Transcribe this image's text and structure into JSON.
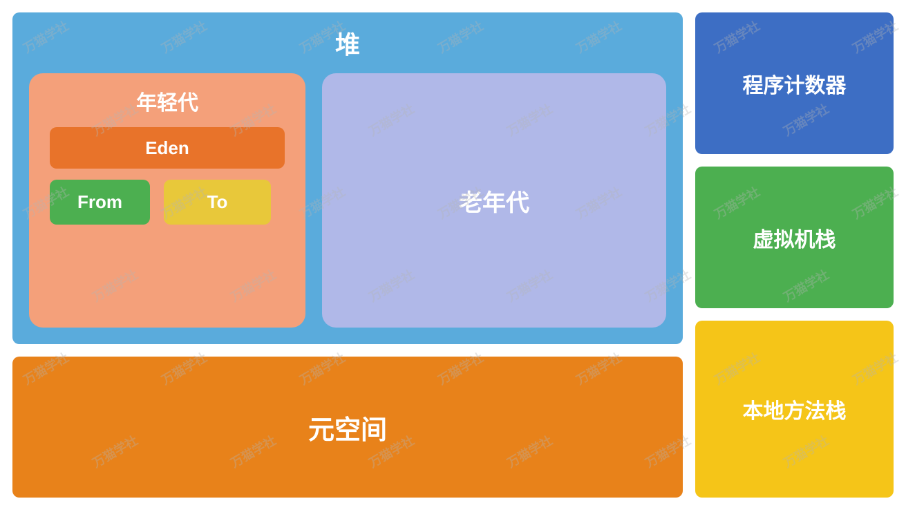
{
  "heap": {
    "title": "堆",
    "youngGen": {
      "title": "年轻代",
      "eden": "Eden",
      "from": "From",
      "to": "To"
    },
    "oldGen": {
      "title": "老年代"
    }
  },
  "metaspace": {
    "title": "元空间"
  },
  "programCounter": {
    "title": "程序计数器"
  },
  "vmStack": {
    "title": "虚拟机栈"
  },
  "nativeMethodStack": {
    "title": "本地方法栈"
  },
  "watermark": {
    "text": "万猫学社"
  }
}
